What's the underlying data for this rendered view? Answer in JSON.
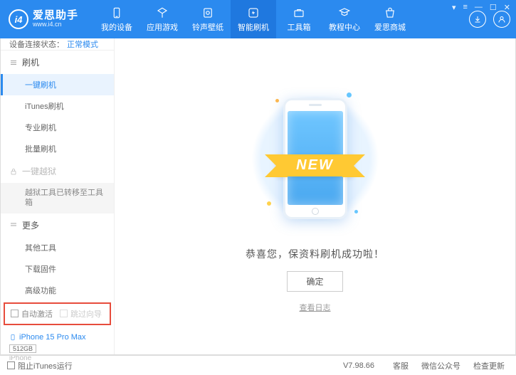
{
  "logo": {
    "title": "爱思助手",
    "url": "www.i4.cn"
  },
  "nav": [
    {
      "label": "我的设备"
    },
    {
      "label": "应用游戏"
    },
    {
      "label": "铃声壁纸"
    },
    {
      "label": "智能刷机"
    },
    {
      "label": "工具箱"
    },
    {
      "label": "教程中心"
    },
    {
      "label": "爱思商城"
    }
  ],
  "status": {
    "label": "设备连接状态：",
    "mode": "正常模式"
  },
  "sidebar": {
    "flash_group": "刷机",
    "items": [
      "一键刷机",
      "iTunes刷机",
      "专业刷机",
      "批量刷机"
    ],
    "jailbreak_group": "一键越狱",
    "jailbreak_note": "越狱工具已转移至工具箱",
    "more_group": "更多",
    "more_items": [
      "其他工具",
      "下载固件",
      "高级功能"
    ]
  },
  "checkboxes": {
    "auto_activate": "自动激活",
    "skip_guide": "跳过向导"
  },
  "device": {
    "name": "iPhone 15 Pro Max",
    "storage": "512GB",
    "type": "iPhone"
  },
  "main": {
    "ribbon": "NEW",
    "success": "恭喜您，保资料刷机成功啦！",
    "ok": "确定",
    "log": "查看日志"
  },
  "footer": {
    "block_itunes": "阻止iTunes运行",
    "version": "V7.98.66",
    "links": [
      "客服",
      "微信公众号",
      "检查更新"
    ]
  }
}
